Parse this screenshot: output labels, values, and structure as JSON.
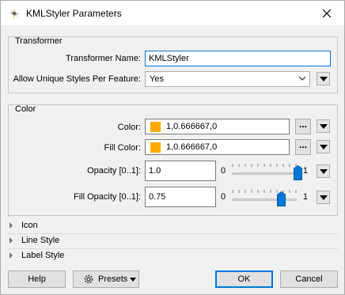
{
  "window": {
    "title": "KMLStyler Parameters",
    "app_icon": "fme-workbench-icon",
    "close_icon": "close-icon"
  },
  "transformer": {
    "group_title": "Transformer",
    "name_label": "Transformer Name:",
    "name_value": "KMLStyler",
    "unique_label": "Allow Unique Styles Per Feature:",
    "unique_value": "Yes"
  },
  "color": {
    "group_title": "Color",
    "color_label": "Color:",
    "color_value": "1,0.666667,0",
    "color_swatch": "#ffaa00",
    "fill_label": "Fill Color:",
    "fill_value": "1,0.666667,0",
    "fill_swatch": "#ffaa00",
    "opacity_label": "Opacity [0..1]:",
    "opacity_value": "1.0",
    "opacity_level": 1.0,
    "fill_opacity_label": "Fill Opacity [0..1]:",
    "fill_opacity_value": "0.75",
    "fill_opacity_level": 0.75,
    "slider_min": "0",
    "slider_max": "1",
    "dots": "..."
  },
  "sections": {
    "icon": "Icon",
    "line_style": "Line Style",
    "label_style": "Label Style"
  },
  "buttons": {
    "help": "Help",
    "presets": "Presets",
    "ok": "OK",
    "cancel": "Cancel"
  },
  "accent_color": "#0078d7"
}
